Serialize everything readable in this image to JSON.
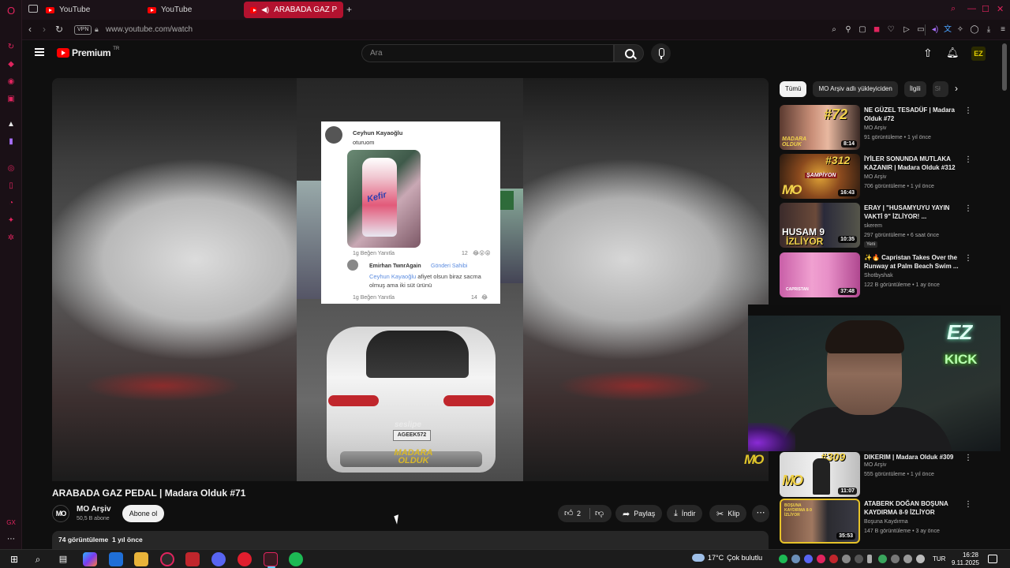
{
  "browser": {
    "tabs": [
      {
        "label": "YouTube"
      },
      {
        "label": "YouTube"
      },
      {
        "label": "ARABADA GAZ PEDAL"
      }
    ],
    "new_tab_label": "+",
    "vpn_badge": "VPN",
    "url": "www.youtube.com/watch",
    "accent_color": "#e0245e"
  },
  "header": {
    "logo_text": "Premium",
    "logo_country": "TR",
    "search_placeholder": "Ara"
  },
  "video": {
    "title": "ARABADA GAZ PEDAL | Madara Olduk #71",
    "watermark_channel": "MO",
    "overlay": {
      "comment_author": "Ceyhun Kayaoğlu",
      "comment_text": "oturuom",
      "bottle_text": "Kefir",
      "comment_actions": "1g    Beğen    Yanıtla",
      "comment_likes": "12",
      "reply_author": "Emirhan TwnrAgain",
      "reply_tag": "Gönderi Sahibi",
      "reply_mention": "Ceyhun Kayaoğlu",
      "reply_text": " afiyet olsun biraz sacma olmuş ama iki süt ürünü",
      "reply_actions": "1g    Beğen    Yanıtla",
      "reply_likes": "14",
      "plate": "AGEEK572",
      "watermark_top": "seslipe",
      "watermark_bottom": "MADARA OLDUK"
    }
  },
  "channel": {
    "avatar_text": "MO",
    "name": "MO Arşiv",
    "subscribers": "50,5 B abone",
    "subscribe_label": "Abone ol"
  },
  "actions": {
    "like_count": "2",
    "share_label": "Paylaş",
    "download_label": "İndir",
    "clip_label": "Klip"
  },
  "description": {
    "views": "74 görüntüleme",
    "date": "1 yıl önce"
  },
  "chips": [
    {
      "label": "Tümü"
    },
    {
      "label": "MO Arşiv adlı yükleyiciden"
    },
    {
      "label": "İlgili"
    },
    {
      "label": "Sł"
    }
  ],
  "recommendations": [
    {
      "title": "NE GÜZEL TESADÜF | Madara Olduk #72",
      "channel": "MO Arşiv",
      "meta": "91 görüntüleme • 1 yıl önce",
      "duration": "8:14",
      "thumb_text": "#72",
      "thumb_sub": "MADARA OLDUK"
    },
    {
      "title": "İYİLER SONUNDA MUTLAKA KAZANIR | Madara Olduk #312",
      "channel": "MO Arşiv",
      "meta": "706 görüntüleme • 1 yıl önce",
      "duration": "16:43",
      "thumb_text": "#312",
      "thumb_sub": "ŞAMPİYON"
    },
    {
      "title": "ERAY | \"HUSAMYUYU YAYIN VAKTİ 9\" İZLİYOR! ...",
      "channel": "skerem",
      "meta": "297 görüntüleme • 6 saat önce",
      "duration": "10:35",
      "thumb_text": "HUSAM 9",
      "thumb_sub": "İZLİYOR",
      "badge": "Yeni"
    },
    {
      "title": "✨🔥 Capristan Takes Over the Runway at Palm Beach Swim ...",
      "channel": "Shotbyshak",
      "meta": "122 B görüntüleme • 1 ay önce",
      "duration": "37:48",
      "thumb_text": "CAPRISTAN"
    },
    {
      "title": "DIKERIM | Madara Olduk #309",
      "channel": "MO Arşiv",
      "meta": "555 görüntüleme • 1 yıl önce",
      "duration": "11:07",
      "thumb_text": "#309"
    },
    {
      "title": "ATABERK DOĞAN BOŞUNA KAYDIRMA 8-9 İZLİYOR",
      "channel": "Boşuna Kaydırma",
      "meta": "147 B görüntüleme • 3 ay önce",
      "duration": "35:53",
      "thumb_text": "BOŞUNA KAYDIRMA 8-9 İZLİYOR"
    }
  ],
  "webcam": {
    "neon_top": "EZ",
    "neon_bottom": "KICK"
  },
  "taskbar": {
    "temperature": "17°C",
    "weather": "Çok bulutlu",
    "language": "TUR",
    "time": "16:28",
    "date": "9.11.2025"
  }
}
